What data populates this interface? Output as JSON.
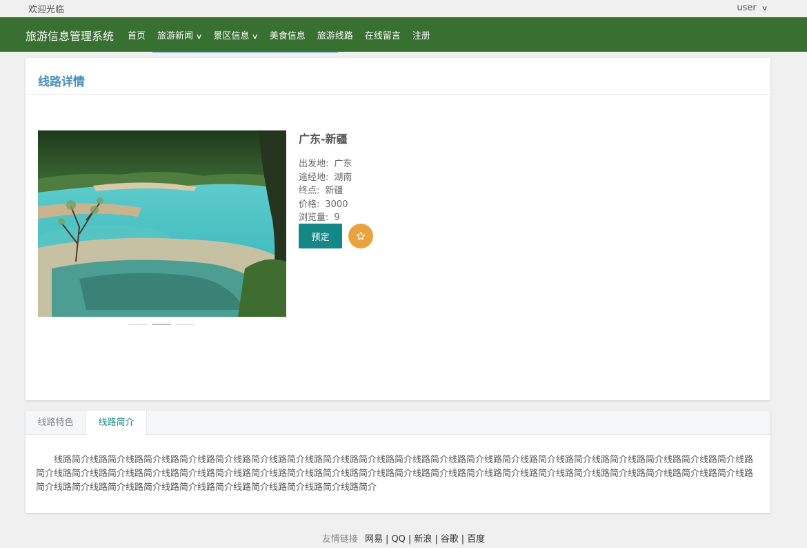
{
  "topbar": {
    "welcome": "欢迎光临",
    "user": "user"
  },
  "nav": {
    "brand": "旅游信息管理系统",
    "items": [
      {
        "label": "首页",
        "dropdown": false
      },
      {
        "label": "旅游新闻",
        "dropdown": true
      },
      {
        "label": "景区信息",
        "dropdown": true
      },
      {
        "label": "美食信息",
        "dropdown": false
      },
      {
        "label": "旅游线路",
        "dropdown": false
      },
      {
        "label": "在线留言",
        "dropdown": false
      },
      {
        "label": "注册",
        "dropdown": false
      }
    ]
  },
  "detail": {
    "title": "线路详情",
    "route_name": "广东-新疆",
    "fields": {
      "origin_label": "出发地:",
      "origin": "广东",
      "via_label": "途经地:",
      "via": "湖南",
      "dest_label": "终点:",
      "dest": "新疆",
      "price_label": "价格:",
      "price": "3000",
      "views_label": "浏览量:",
      "views": "9"
    },
    "book_label": "预定",
    "carousel": {
      "slide_count": 3,
      "active_index": 1
    }
  },
  "tabs": {
    "items": [
      "线路特色",
      "线路简介"
    ],
    "active": 1,
    "content": "线路简介线路简介线路简介线路简介线路简介线路简介线路简介线路简介线路简介线路简介线路简介线路简介线路简介线路简介线路简介线路简介线路简介线路简介线路简介线路简介线路简介线路简介线路简介线路简介线路简介线路简介线路简介线路简介线路简介线路简介线路简介线路简介线路简介线路简介线路简介线路简介线路简介线路简介线路简介线路简介线路简介线路简介线路简介线路简介线路简介线路简介线路简介线路简介线路简介"
  },
  "footer": {
    "lead": "友情链接",
    "links": [
      "网易",
      "QQ",
      "新浪",
      "谷歌",
      "百度"
    ]
  },
  "colors": {
    "nav_bg": "#377030",
    "accent": "#158786",
    "title_blue": "#4a90b8",
    "favorite": "#e8a33d"
  },
  "icons": {
    "user_menu": "chevron-down-icon",
    "favorite": "star-icon"
  }
}
